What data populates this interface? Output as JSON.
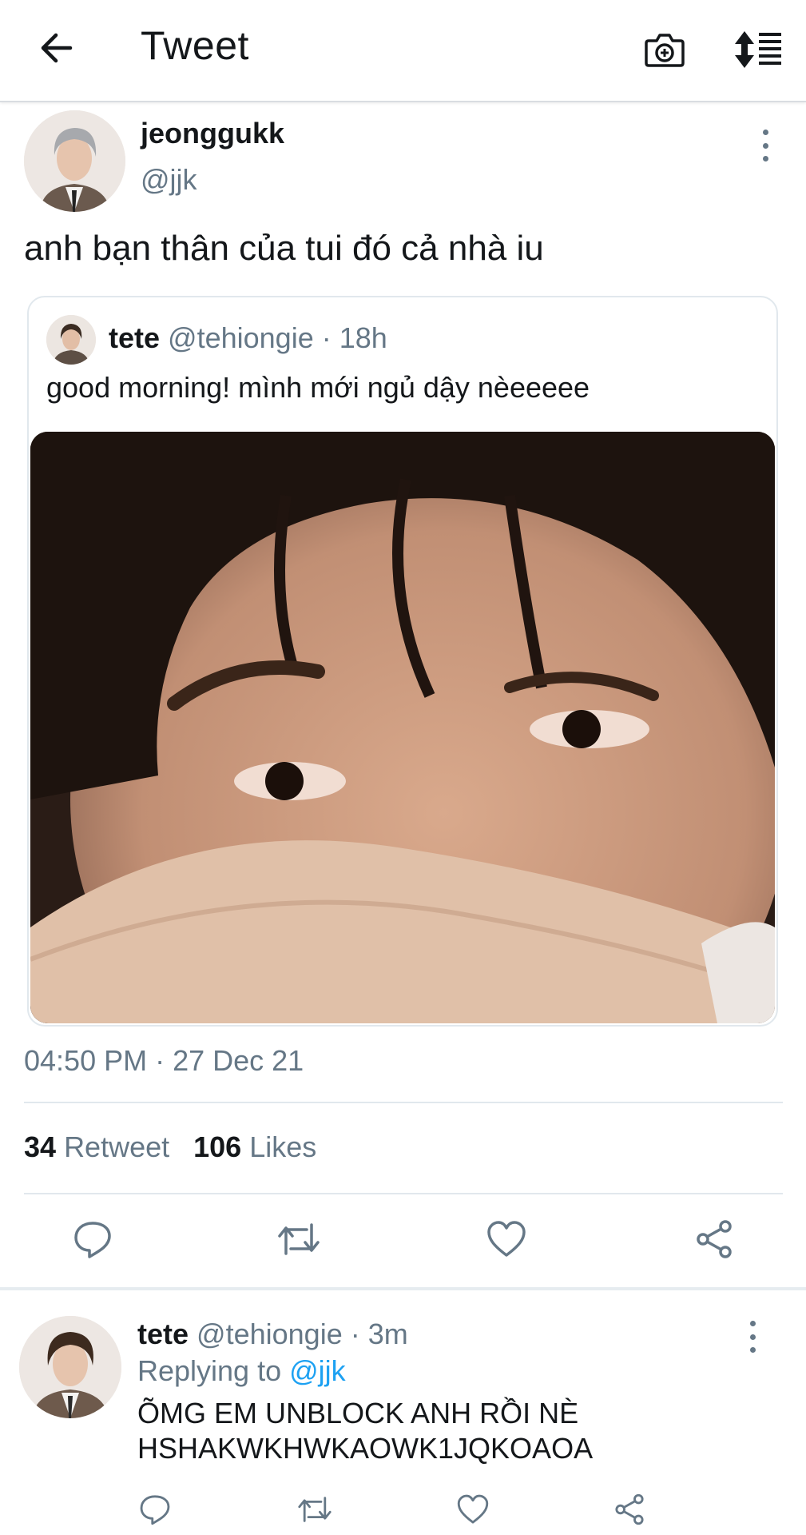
{
  "header": {
    "title": "Tweet",
    "back_icon": "arrow-left-icon",
    "camera_icon": "camera-icon",
    "sort_icon": "sort-icon"
  },
  "tweet": {
    "name": "jeonggukk",
    "handle": "@jjk",
    "text": "anh bạn thân của tui đó cả nhà iu",
    "quoted": {
      "name": "tete",
      "handle_time": "@tehiongie · 18h",
      "text": "good morning! mình mới ngủ dậy nèeeeee"
    },
    "timestamp": "04:50 PM · 27 Dec 21",
    "stats": {
      "retweets": "34",
      "retweets_label": "Retweet",
      "likes": "106",
      "likes_label": "Likes"
    },
    "actions": [
      "reply-icon",
      "retweet-icon",
      "like-icon",
      "share-icon"
    ]
  },
  "reply": {
    "name": "tete",
    "handle_time": "@tehiongie · 3m",
    "replying_label": "Replying to",
    "replying_to": "@jjk",
    "text": "ÕMG EM UNBLOCK ANH RỒI NÈ HSHAKWKHWKAOWK1JQKOAOA"
  },
  "colors": {
    "text": "#14171a",
    "secondary": "#657786",
    "accent": "#1da1f2",
    "border": "#e1e8ed"
  }
}
